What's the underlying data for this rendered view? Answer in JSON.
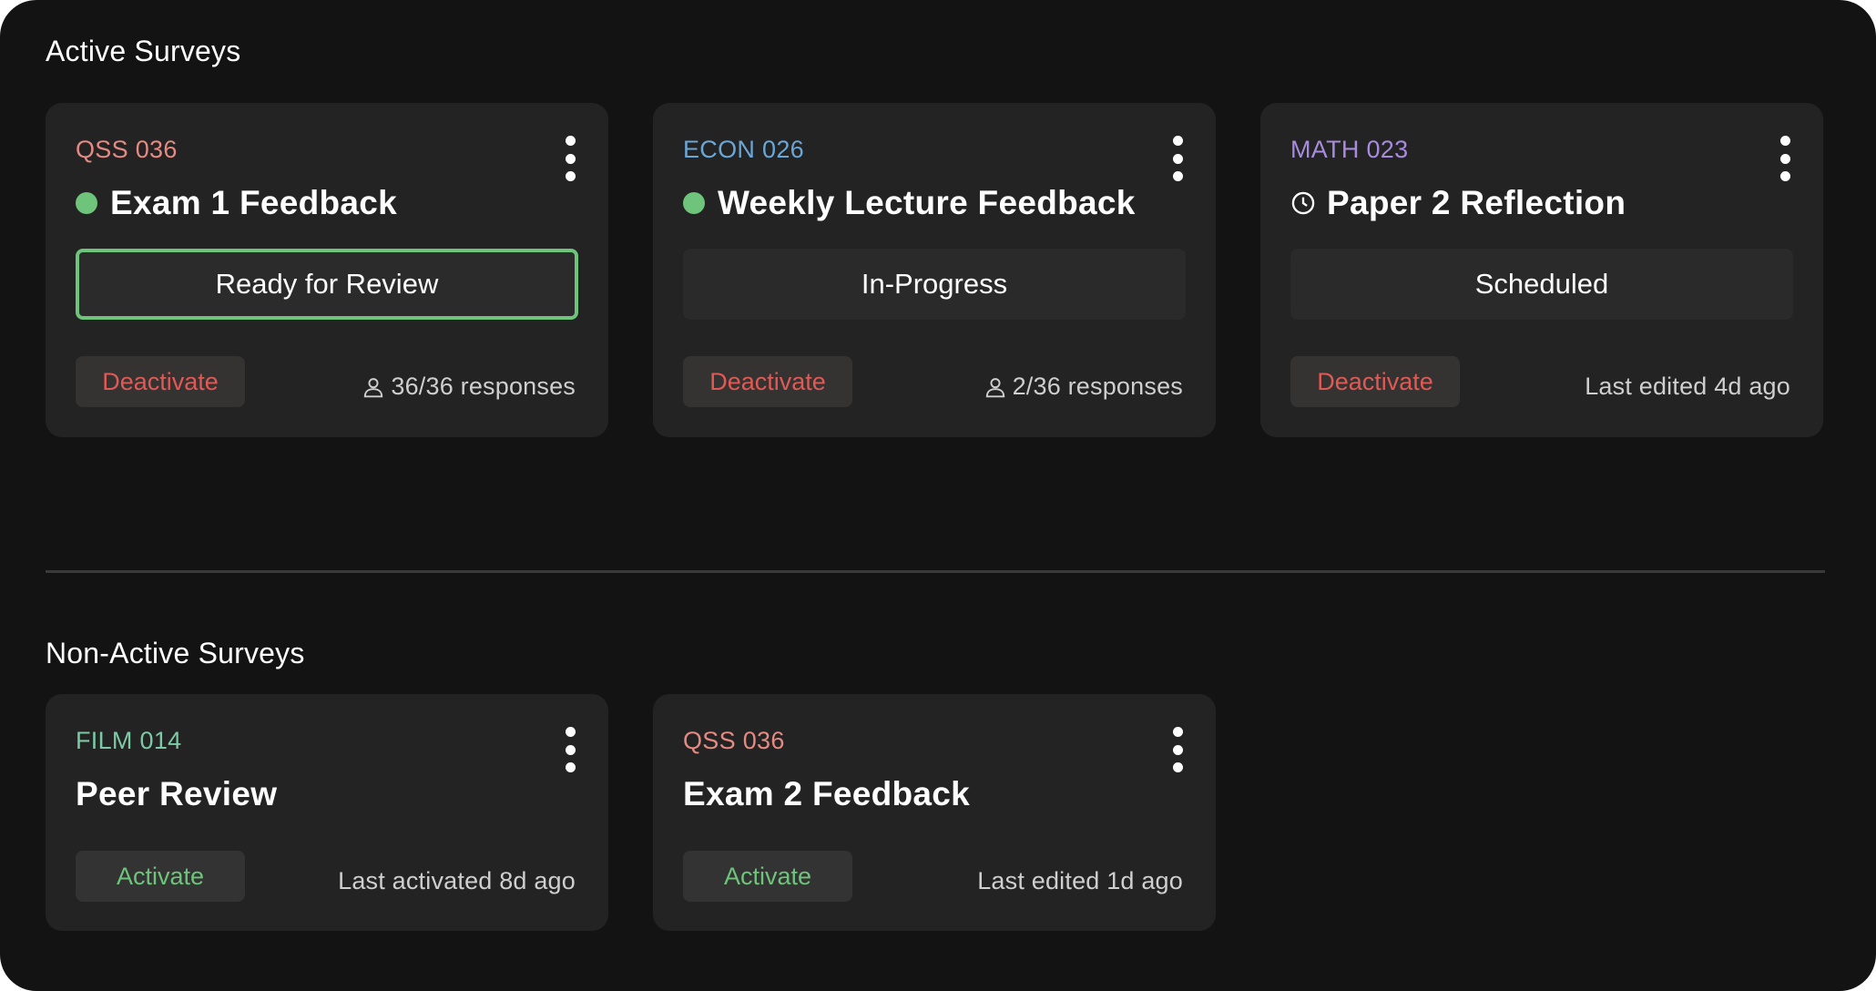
{
  "active_section": {
    "title": "Active Surveys"
  },
  "nonactive_section": {
    "title": "Non-Active Surveys"
  },
  "colors": {
    "background": "#131313",
    "card": "#232323",
    "green": "#6dc47a",
    "red": "#e05a55",
    "qss": "#e48a82",
    "econ": "#6aa6d6",
    "math": "#a78bde",
    "film": "#7cc9a6"
  },
  "active_cards": [
    {
      "course": "QSS 036",
      "title": "Exam 1 Feedback",
      "status_icon": "green-dot",
      "status": "Ready for Review",
      "button": "Deactivate",
      "meta_icon": "person-icon",
      "meta": "36/36 responses"
    },
    {
      "course": "ECON 026",
      "title": "Weekly Lecture Feedback",
      "status_icon": "green-dot",
      "status": "In-Progress",
      "button": "Deactivate",
      "meta_icon": "person-icon",
      "meta": "2/36 responses"
    },
    {
      "course": "MATH 023",
      "title": "Paper 2 Reflection",
      "status_icon": "clock-icon",
      "status": "Scheduled",
      "button": "Deactivate",
      "meta": "Last edited 4d ago"
    }
  ],
  "nonactive_cards": [
    {
      "course": "FILM 014",
      "title": "Peer Review",
      "button": "Activate",
      "meta": "Last activated 8d ago"
    },
    {
      "course": "QSS 036",
      "title": "Exam 2 Feedback",
      "button": "Activate",
      "meta": "Last edited 1d ago"
    }
  ]
}
